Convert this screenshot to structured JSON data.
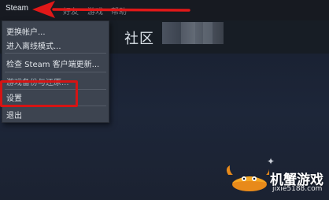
{
  "menubar": {
    "steam_label": "Steam",
    "other_labels": [
      "好友",
      "游戏",
      "帮助"
    ]
  },
  "nav": {
    "community_label": "社区"
  },
  "dropdown": {
    "items": [
      {
        "label": "更换帐户..."
      },
      {
        "label": "进入离线模式..."
      },
      {
        "label": "检查 Steam 客户端更新..."
      },
      {
        "label": "游戏备份与还原..."
      },
      {
        "label": "设置"
      },
      {
        "label": "退出"
      }
    ]
  },
  "annotation": {
    "arrow_color": "#e01818",
    "highlight_color": "#d51414"
  },
  "watermark": {
    "title": "机蟹游戏",
    "url": "jixie5188.com"
  }
}
